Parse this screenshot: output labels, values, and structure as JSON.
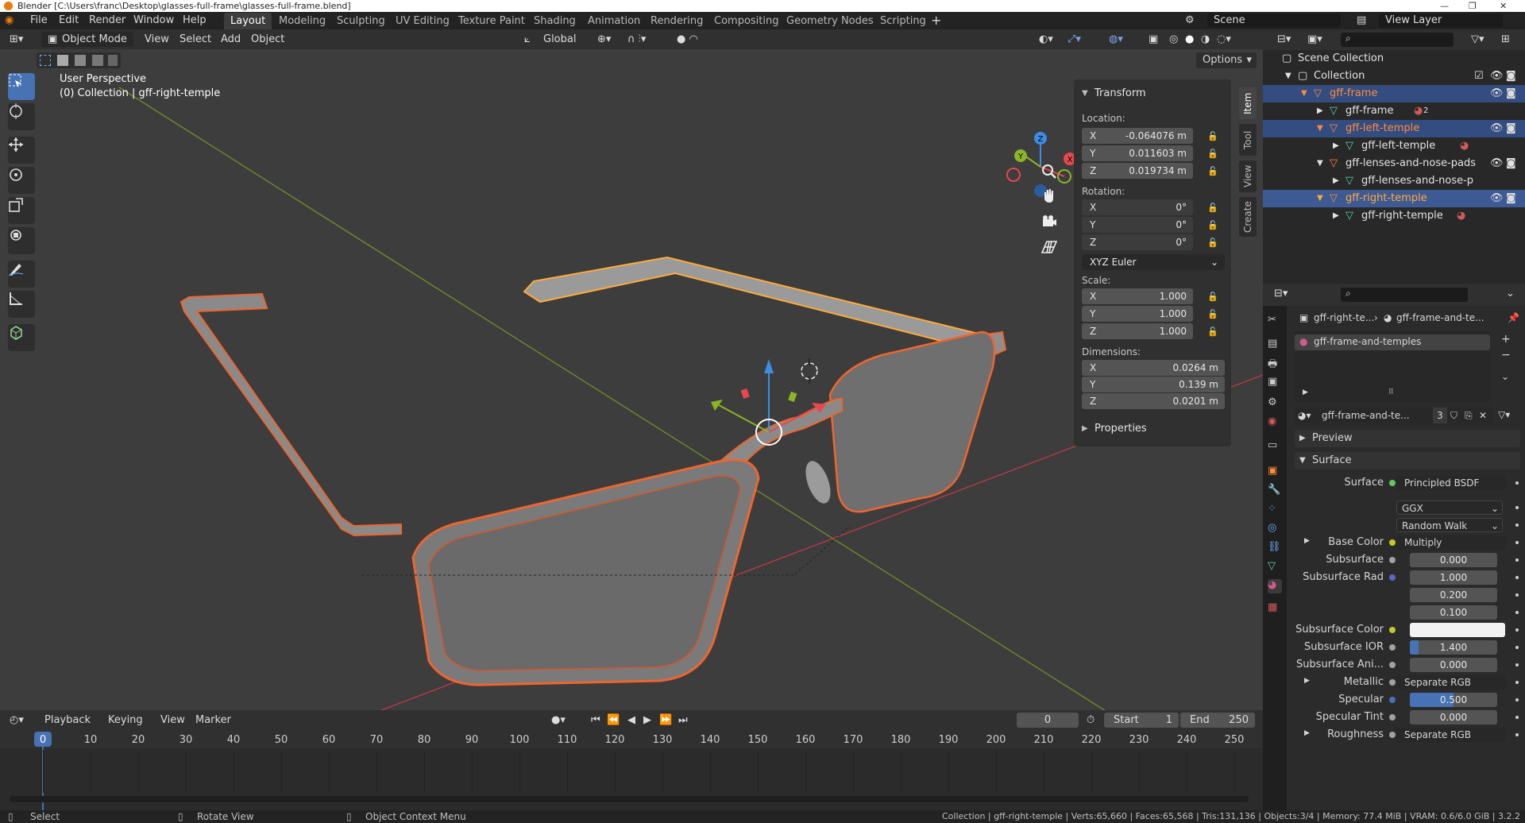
{
  "window": {
    "title": "Blender [C:\\Users\\franc\\Desktop\\glasses-full-frame\\glasses-full-frame.blend]"
  },
  "menu": [
    "File",
    "Edit",
    "Render",
    "Window",
    "Help"
  ],
  "workspaces": [
    "Layout",
    "Modeling",
    "Sculpting",
    "UV Editing",
    "Texture Paint",
    "Shading",
    "Animation",
    "Rendering",
    "Compositing",
    "Geometry Nodes",
    "Scripting"
  ],
  "active_workspace": "Layout",
  "scene": {
    "name": "Scene",
    "view_layer": "View Layer"
  },
  "viewport_header": {
    "mode": "Object Mode",
    "menus": [
      "View",
      "Select",
      "Add",
      "Object"
    ],
    "orientation": "Global",
    "options_label": "Options"
  },
  "viewport": {
    "perspective": "User Perspective",
    "context": "(0) Collection | gff-right-temple",
    "axes": [
      "X",
      "Y",
      "Z"
    ]
  },
  "sidebar_tabs": [
    "Item",
    "Tool",
    "View",
    "Create"
  ],
  "transform": {
    "title": "Transform",
    "location_label": "Location:",
    "location": [
      {
        "axis": "X",
        "value": "-0.064076 m"
      },
      {
        "axis": "Y",
        "value": "0.011603 m"
      },
      {
        "axis": "Z",
        "value": "0.019734 m"
      }
    ],
    "rotation_label": "Rotation:",
    "rotation": [
      {
        "axis": "X",
        "value": "0°"
      },
      {
        "axis": "Y",
        "value": "0°"
      },
      {
        "axis": "Z",
        "value": "0°"
      }
    ],
    "rotation_mode": "XYZ Euler",
    "scale_label": "Scale:",
    "scale": [
      {
        "axis": "X",
        "value": "1.000"
      },
      {
        "axis": "Y",
        "value": "1.000"
      },
      {
        "axis": "Z",
        "value": "1.000"
      }
    ],
    "dimensions_label": "Dimensions:",
    "dimensions": [
      {
        "axis": "X",
        "value": "0.0264 m"
      },
      {
        "axis": "Y",
        "value": "0.139 m"
      },
      {
        "axis": "Z",
        "value": "0.0201 m"
      }
    ],
    "properties_label": "Properties"
  },
  "timeline": {
    "menus": [
      "Playback",
      "Keying",
      "View",
      "Marker"
    ],
    "current_frame": "0",
    "start_label": "Start",
    "start": "1",
    "end_label": "End",
    "end": "250",
    "frame_labels": [
      "0",
      "10",
      "20",
      "30",
      "40",
      "50",
      "60",
      "70",
      "80",
      "90",
      "100",
      "110",
      "120",
      "130",
      "140",
      "150",
      "160",
      "170",
      "180",
      "190",
      "200",
      "210",
      "220",
      "230",
      "240",
      "250"
    ]
  },
  "statusbar": {
    "select": "Select",
    "rotate": "Rotate View",
    "context_menu": "Object Context Menu",
    "info": "Collection | gff-right-temple | Verts:65,660 | Faces:65,568 | Tris:131,136 | Objects:3/4 | Memory: 77.4 MiB | VRAM: 0.6/6.0 GiB | 3.2.2"
  },
  "outliner": {
    "scene_collection": "Scene Collection",
    "collection": "Collection",
    "items": [
      {
        "name": "gff-frame",
        "kind": "object",
        "selected": true
      },
      {
        "name": "gff-frame",
        "kind": "mesh",
        "badge": "2"
      },
      {
        "name": "gff-left-temple",
        "kind": "object",
        "selected": true
      },
      {
        "name": "gff-left-temple",
        "kind": "mesh"
      },
      {
        "name": "gff-lenses-and-nose-pads",
        "kind": "object"
      },
      {
        "name": "gff-lenses-and-nose-p",
        "kind": "mesh"
      },
      {
        "name": "gff-right-temple",
        "kind": "object",
        "active": true
      },
      {
        "name": "gff-right-temple",
        "kind": "mesh"
      }
    ]
  },
  "properties": {
    "breadcrumb": [
      "gff-right-te...",
      "gff-frame-and-te..."
    ],
    "material_slot": "gff-frame-and-temples",
    "material_name": "gff-frame-and-te...",
    "users": "3",
    "preview_label": "Preview",
    "surface_panel": "Surface",
    "rows": [
      {
        "label": "Surface",
        "kind": "link",
        "value": "Principled BSDF",
        "dot": "#63c763"
      },
      {
        "label": "",
        "kind": "drop",
        "value": "GGX"
      },
      {
        "label": "",
        "kind": "drop",
        "value": "Random Walk"
      },
      {
        "label": "Base Color",
        "kind": "link",
        "value": "Multiply",
        "dot": "#c7c729",
        "expand": true
      },
      {
        "label": "Subsurface",
        "kind": "num",
        "value": "0.000",
        "dot": "#a1a1a1"
      },
      {
        "label": "Subsurface Rad",
        "kind": "num",
        "value": "1.000",
        "dot": "#6363c7"
      },
      {
        "label": "",
        "kind": "num",
        "value": "0.200"
      },
      {
        "label": "",
        "kind": "num",
        "value": "0.100"
      },
      {
        "label": "Subsurface Color",
        "kind": "color",
        "value": "",
        "dot": "#c7c729"
      },
      {
        "label": "Subsurface IOR",
        "kind": "num",
        "value": "1.400",
        "dot": "#a1a1a1",
        "fill": 0.1
      },
      {
        "label": "Subsurface Ani...",
        "kind": "num",
        "value": "0.000",
        "dot": "#a1a1a1"
      },
      {
        "label": "Metallic",
        "kind": "link",
        "value": "Separate RGB",
        "dot": "#a1a1a1",
        "expand": true
      },
      {
        "label": "Specular",
        "kind": "num",
        "value": "0.500",
        "dot": "#4772b3",
        "fill": 0.5
      },
      {
        "label": "Specular Tint",
        "kind": "num",
        "value": "0.000",
        "dot": "#a1a1a1"
      },
      {
        "label": "Roughness",
        "kind": "link",
        "value": "Separate RGB",
        "dot": "#a1a1a1",
        "expand": true
      }
    ]
  },
  "colors": {
    "accent": "#4772b3",
    "selected_outline": "#f0652d",
    "active_outline": "#ffaa3c",
    "x_axis": "#e8474f",
    "y_axis": "#8ab524",
    "z_axis": "#3a8ee6"
  }
}
